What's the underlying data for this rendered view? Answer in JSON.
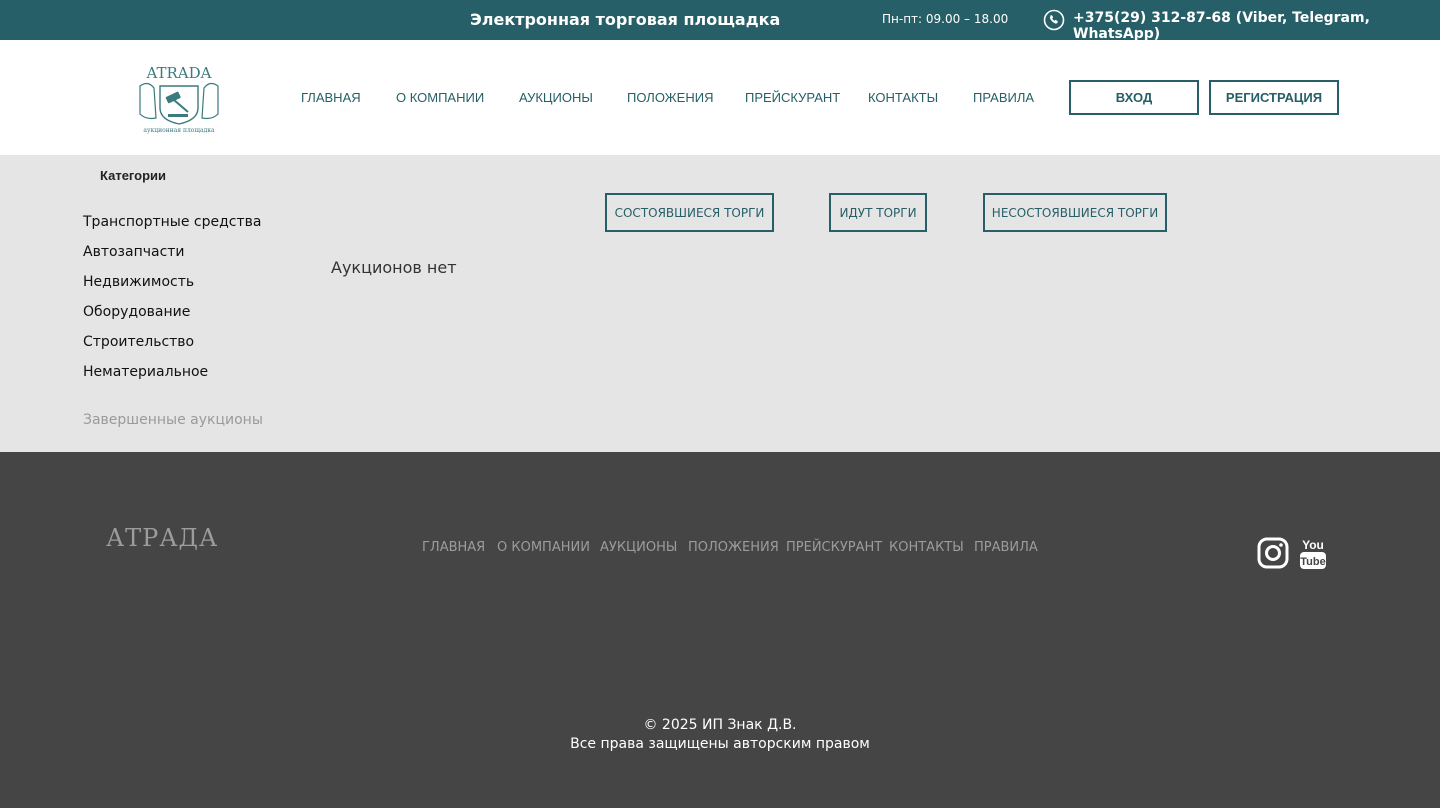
{
  "topbar": {
    "title": "Электронная торговая площадка",
    "hours": "Пн-пт: 09.00 – 18.00",
    "phone": "+375(29) 312-87-68 (Viber, Telegram, WhatsApp)",
    "phone_icon": "phone-icon"
  },
  "header": {
    "logo_text": "ATRADA",
    "logo_subtext": "аукционная площадка",
    "nav": [
      "Главная",
      "О компании",
      "Аукционы",
      "Положения",
      "Прейскурант",
      "Контакты",
      "Правила"
    ],
    "login_label": "Вход",
    "register_label": "Регистрация"
  },
  "sidebar": {
    "heading": "Категории",
    "categories": [
      "Транспортные средства",
      "Автозапчасти",
      "Недвижимость",
      "Оборудование",
      "Строительство",
      "Нематериальное"
    ],
    "finished_link": "Завершенные аукционы"
  },
  "filters": {
    "completed": "Состоявшиеся торги",
    "ongoing": "Идут торги",
    "failed": "Несостоявшиеся торги"
  },
  "main": {
    "empty_text": "Аукционов нет"
  },
  "footer": {
    "logo": "АТРАДА",
    "nav": [
      "Главная",
      "О компании",
      "Аукционы",
      "Положения",
      "Прейскурант",
      "Контакты",
      "Правила"
    ],
    "social": [
      "instagram-icon",
      "youtube-icon"
    ],
    "copyright": "© 2025 ИП Знак Д.В.",
    "rights": "Все права защищены авторским правом"
  },
  "colors": {
    "brand": "#265f67",
    "main_bg": "#e5e5e5",
    "footer_bg": "#454545"
  }
}
